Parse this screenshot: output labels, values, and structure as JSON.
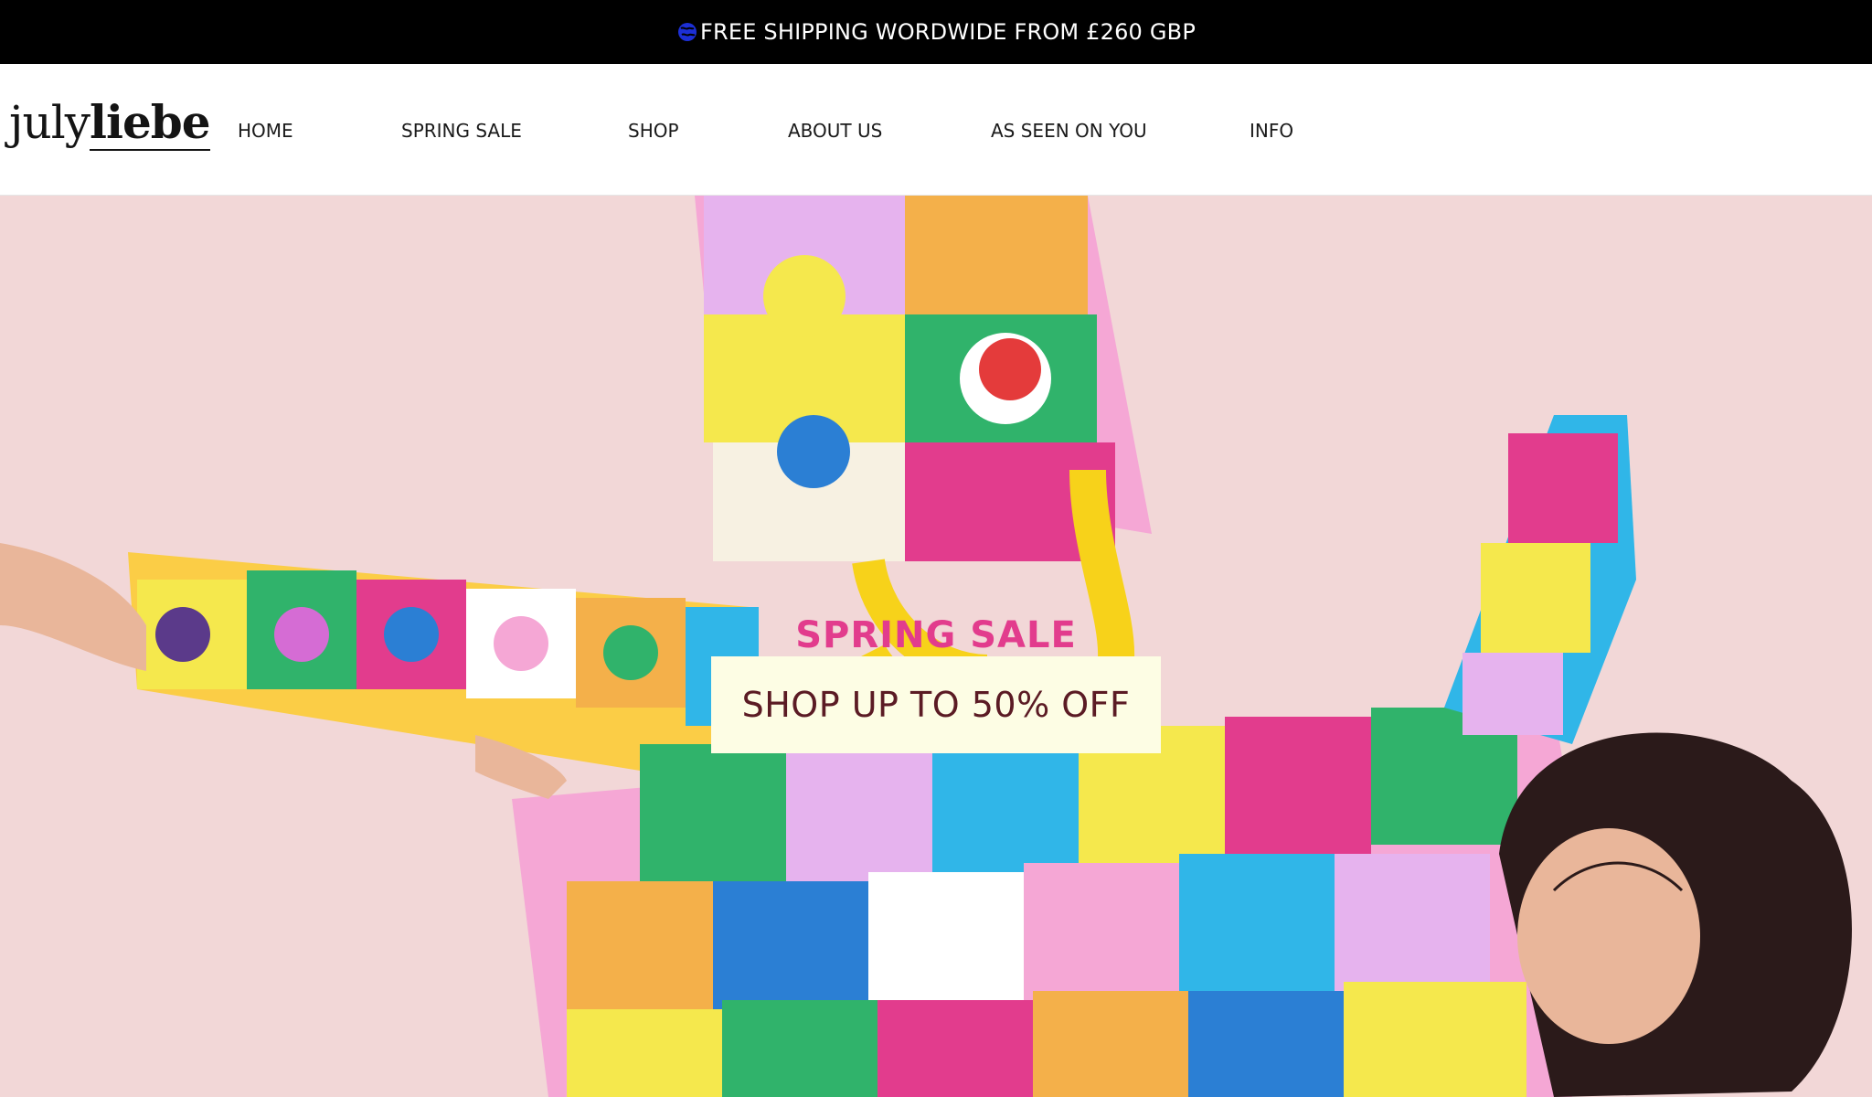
{
  "announcement": {
    "text": "FREE SHIPPING WORDWIDE FROM £260 GBP",
    "icon": "globe-icon",
    "icon_color": "#1c2fd6"
  },
  "header": {
    "logo": {
      "light": "july",
      "bold": "liebe"
    },
    "nav": [
      {
        "label": "HOME"
      },
      {
        "label": "SPRING SALE"
      },
      {
        "label": "SHOP"
      },
      {
        "label": "ABOUT US"
      },
      {
        "label": "AS SEEN ON YOU"
      },
      {
        "label": "INFO"
      }
    ]
  },
  "hero": {
    "kicker": "SPRING SALE",
    "cta_label": "SHOP UP TO 50% OFF",
    "colors": {
      "background": "#f2d7d7",
      "kicker": "#e23c8d",
      "cta_bg": "#fdfde4",
      "cta_text": "#5b1b24"
    }
  }
}
